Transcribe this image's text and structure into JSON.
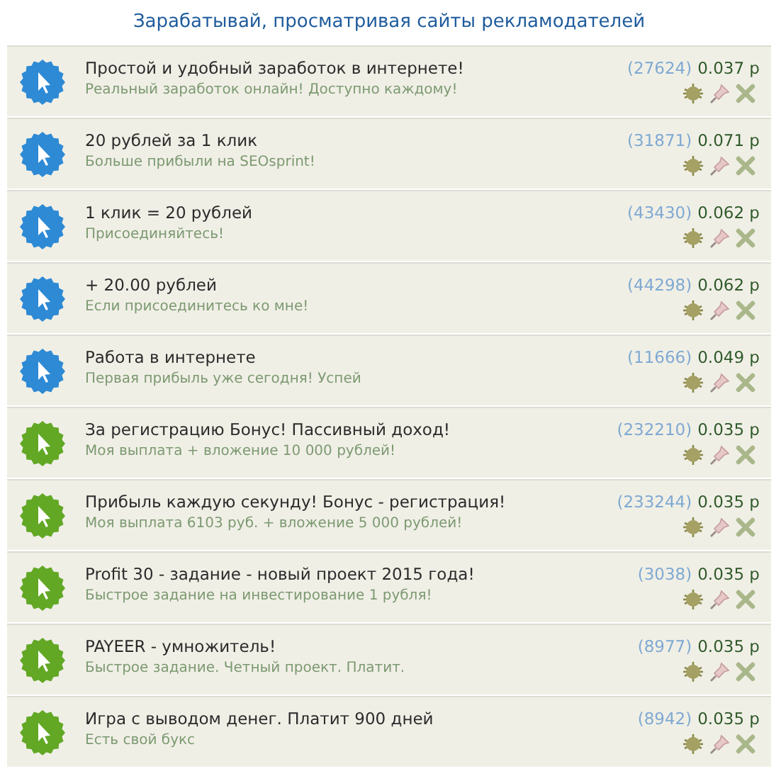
{
  "header": {
    "title": "Зарабатывай, просматривая сайты рекламодателей"
  },
  "ads": [
    {
      "title": "Простой и удобный заработок в интернете!",
      "subtitle": "Реальный заработок онлайн! Доступно каждому!",
      "views": "(27624)",
      "price": "0.037 р",
      "color": "#2e8ad4"
    },
    {
      "title": "20 рублей за 1 клик",
      "subtitle": "Больше прибыли на SEOsprint!",
      "views": "(31871)",
      "price": "0.071 р",
      "color": "#2e8ad4"
    },
    {
      "title": "1 клик = 20 рублей",
      "subtitle": "Присоединяйтесь!",
      "views": "(43430)",
      "price": "0.062 р",
      "color": "#2e8ad4"
    },
    {
      "title": "+ 20.00 рублей",
      "subtitle": "Если присоединитесь ко мне!",
      "views": "(44298)",
      "price": "0.062 р",
      "color": "#2e8ad4"
    },
    {
      "title": "Работа в интернете",
      "subtitle": "Первая прибыль уже сегодня! Успей",
      "views": "(11666)",
      "price": "0.049 р",
      "color": "#2e8ad4"
    },
    {
      "title": "За регистрацию Бонус! Пассивный доход!",
      "subtitle": "Моя выплата + вложение 10 000 рублей!",
      "views": "(232210)",
      "price": "0.035 р",
      "color": "#62a825"
    },
    {
      "title": "Прибыль каждую секунду! Бонус - регистрация!",
      "subtitle": "Моя выплата 6103 руб. + вложение 5 000 рублей!",
      "views": "(233244)",
      "price": "0.035 р",
      "color": "#62a825"
    },
    {
      "title": "Profit 30 - задание - новый проект 2015 года!",
      "subtitle": "Быстрое задание на инвестирование 1 рубля!",
      "views": "(3038)",
      "price": "0.035 р",
      "color": "#62a825"
    },
    {
      "title": "PAYEER - умножитель!",
      "subtitle": "Быстрое задание. Четный проект. Платит.",
      "views": "(8977)",
      "price": "0.035 р",
      "color": "#62a825"
    },
    {
      "title": "Игра с выводом денег. Платит 900 дней",
      "subtitle": "Есть свой букс",
      "views": "(8942)",
      "price": "0.035 р",
      "color": "#62a825"
    }
  ]
}
